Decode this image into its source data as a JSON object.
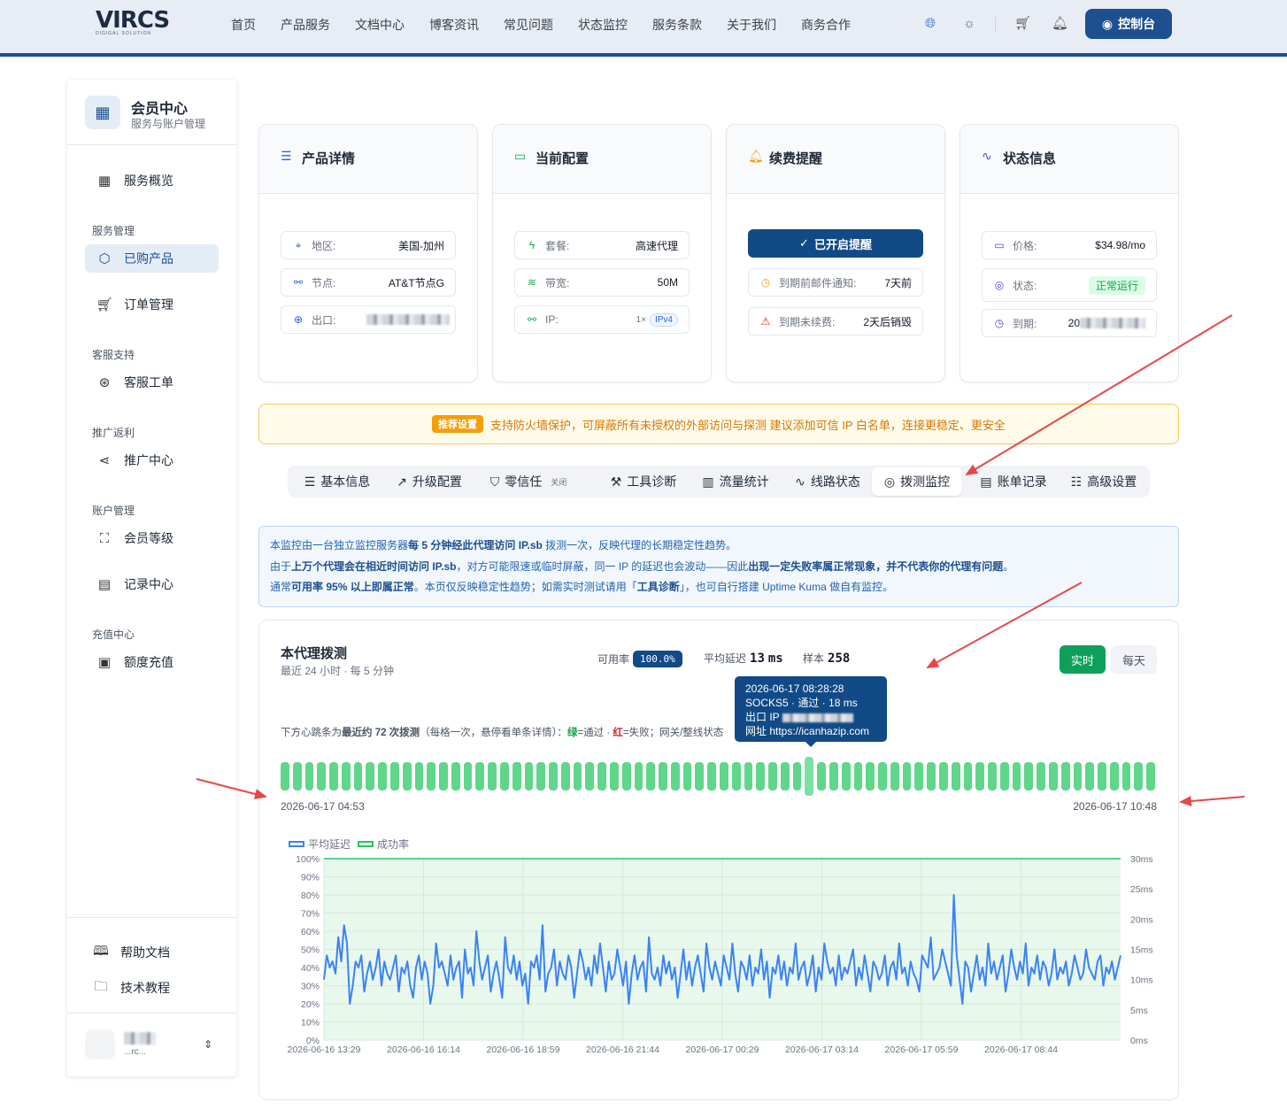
{
  "brand": {
    "logo": "VIRCS",
    "tagline": "DIGIGAL SOLUTION"
  },
  "nav": [
    "首页",
    "产品服务",
    "文档中心",
    "博客资讯",
    "常见问题",
    "状态监控",
    "服务条款",
    "关于我们",
    "商务合作"
  ],
  "console_label": "控制台",
  "sidebar": {
    "title": "会员中心",
    "subtitle": "服务与账户管理",
    "overview": "服务概览",
    "groups": [
      {
        "label": "服务管理",
        "items": [
          "已购产品",
          "订单管理"
        ]
      },
      {
        "label": "客服支持",
        "items": [
          "客服工单"
        ]
      },
      {
        "label": "推广返利",
        "items": [
          "推广中心"
        ]
      },
      {
        "label": "账户管理",
        "items": [
          "会员等级",
          "记录中心"
        ]
      },
      {
        "label": "充值中心",
        "items": [
          "额度充值"
        ]
      }
    ],
    "bottom": [
      "帮助文档",
      "技术教程"
    ]
  },
  "cards": {
    "product": {
      "title": "产品详情",
      "region_label": "地区:",
      "region": "美国-加州",
      "node_label": "节点:",
      "node": "AT&T节点G",
      "exit_label": "出口:"
    },
    "config": {
      "title": "当前配置",
      "plan_label": "套餐:",
      "plan": "高速代理",
      "bw_label": "带宽:",
      "bw": "50M",
      "ip_label": "IP:",
      "ip_count": "1×",
      "ip_type": "IPv4"
    },
    "renew": {
      "title": "续费提醒",
      "enabled": "已开启提醒",
      "mail_label": "到期前邮件通知:",
      "mail": "7天前",
      "expire_label": "到期未续费:",
      "expire": "2天后销毁"
    },
    "status": {
      "title": "状态信息",
      "price_label": "价格:",
      "price": "$34.98/mo",
      "state_label": "状态:",
      "state": "正常运行",
      "due_label": "到期:",
      "due": "20"
    }
  },
  "notice": {
    "tag": "推荐设置",
    "text": "支持防火墙保护，可屏蔽所有未授权的外部访问与探测  建议添加可信 IP 白名单，连接更稳定、更安全"
  },
  "tabs": [
    {
      "label": "基本信息",
      "icon": "server-icon"
    },
    {
      "label": "升级配置",
      "icon": "trend-icon"
    },
    {
      "label": "零信任",
      "icon": "shield-icon",
      "extra": "关闭"
    },
    {
      "label": "工具诊断",
      "icon": "wrench-icon"
    },
    {
      "label": "流量统计",
      "icon": "bar-chart-icon"
    },
    {
      "label": "线路状态",
      "icon": "activity-icon"
    },
    {
      "label": "拨测监控",
      "icon": "radar-icon",
      "active": true
    },
    {
      "label": "账单记录",
      "icon": "receipt-icon"
    },
    {
      "label": "高级设置",
      "icon": "sliders-icon"
    }
  ],
  "info": {
    "l1a": "本监控由一台独立监控服务器",
    "l1b": "每 5 分钟经此代理访问 IP.sb",
    "l1c": " 拨测一次，反映代理的长期稳定性趋势。",
    "l2a": "由于",
    "l2b": "上万个代理会在相近时间访问 IP.sb",
    "l2c": "，对方可能限速或临时屏蔽，同一 IP 的延迟也会波动——因此",
    "l2d": "出现一定失败率属正常现象，并不代表你的代理有问题",
    "l2e": "。",
    "l3a": "通常",
    "l3b": "可用率 95% 以上即属正常",
    "l3c": "。本页仅反映稳定性趋势；如需实时测试请用「",
    "l3d": "工具诊断",
    "l3e": "」，也可自行搭建 Uptime Kuma 做自有监控。"
  },
  "probe": {
    "title": "本代理拨测",
    "subtitle": "最近 24 小时 · 每 5 分钟",
    "avail_label": "可用率",
    "avail": "100.0%",
    "latency_label": "平均延迟",
    "latency": "13",
    "latency_unit": "ms",
    "sample_label": "样本",
    "sample": "258",
    "btn_realtime": "实时",
    "btn_daily": "每天",
    "hint_a": "下方心跳条为",
    "hint_b": "最近约 72 次拨测",
    "hint_c": "（每格一次，悬停看单条详情）：",
    "hint_green": "绿",
    "hint_d": "=通过 · ",
    "hint_red": "红",
    "hint_e": "=失败；网关/整线状态",
    "beats_count": 72,
    "beat_highlight": 43,
    "start": "2026-06-17 04:53",
    "end": "2026-06-17 10:48",
    "tooltip": {
      "time": "2026-06-17 08:28:28",
      "line2": "SOCKS5 · 通过 · 18 ms",
      "line3": "出口 IP",
      "line4": "网址 https://icanhazip.com"
    }
  },
  "chart_data": {
    "type": "line",
    "legend": [
      "平均延迟",
      "成功率"
    ],
    "colors": {
      "latency": "#3b82f6",
      "success": "#22c55e"
    },
    "y_left": [
      "100%",
      "90%",
      "80%",
      "70%",
      "60%",
      "50%",
      "40%",
      "30%",
      "20%",
      "10%",
      "0%"
    ],
    "y_right": [
      "30ms",
      "25ms",
      "20ms",
      "15ms",
      "10ms",
      "5ms",
      "0ms"
    ],
    "x_labels": [
      "2026-06-16 13:29",
      "2026-06-16 16:14",
      "2026-06-16 18:59",
      "2026-06-16 21:44",
      "2026-06-17 00:29",
      "2026-06-17 03:14",
      "2026-06-17 05:59",
      "2026-06-17 08:44"
    ],
    "success_rate": 100,
    "latency_ms": [
      10,
      14,
      12,
      13,
      11,
      17,
      13,
      19,
      16,
      6,
      9,
      13,
      12,
      14,
      8,
      11,
      13,
      10,
      12,
      15,
      9,
      13,
      11,
      10,
      12,
      14,
      8,
      12,
      11,
      13,
      9,
      7,
      12,
      14,
      10,
      13,
      11,
      6,
      9,
      16,
      12,
      13,
      11,
      9,
      14,
      10,
      12,
      13,
      7,
      15,
      11,
      12,
      9,
      18,
      13,
      10,
      12,
      14,
      8,
      11,
      13,
      10,
      7,
      17,
      12,
      11,
      14,
      10,
      13,
      9,
      11,
      6,
      13,
      12,
      14,
      10,
      19,
      8,
      11,
      12,
      15,
      9,
      13,
      11,
      10,
      14,
      12,
      7,
      11,
      15,
      13,
      10,
      12,
      9,
      14,
      11,
      16,
      12,
      8,
      13,
      10,
      11,
      15,
      12,
      9,
      13,
      6,
      11,
      14,
      10,
      12,
      13,
      8,
      17,
      11,
      10,
      12,
      9,
      14,
      11,
      13,
      10,
      12,
      7,
      11,
      15,
      10,
      13,
      9,
      12,
      14,
      11,
      8,
      16,
      12,
      10,
      13,
      11,
      9,
      14,
      12,
      10,
      16,
      11,
      8,
      13,
      12,
      10,
      14,
      9,
      12,
      11,
      15,
      10,
      13,
      7,
      12,
      11,
      14,
      10,
      13,
      9,
      12,
      11,
      16,
      10,
      12,
      13,
      9,
      11,
      14,
      8,
      12,
      10,
      16,
      13,
      11,
      12,
      9,
      14,
      10,
      12,
      11,
      13,
      15,
      9,
      12,
      10,
      14,
      11,
      8,
      13,
      12,
      10,
      11,
      14,
      9,
      12,
      13,
      10,
      16,
      11,
      12,
      9,
      13,
      11,
      10,
      8,
      14,
      13,
      12,
      17,
      10,
      11,
      12,
      15,
      13,
      11,
      9,
      24,
      14,
      10,
      6,
      13,
      12,
      8,
      11,
      14,
      10,
      12,
      9,
      16,
      11,
      13,
      10,
      12,
      14,
      8,
      11,
      15,
      12,
      10,
      13,
      11,
      16,
      9,
      12,
      11,
      14,
      10,
      13,
      12,
      9,
      11,
      15,
      10,
      12,
      11,
      13,
      9,
      11,
      14,
      12,
      10,
      11,
      15,
      12,
      11,
      10,
      13,
      14,
      9,
      12,
      11,
      13,
      10,
      12,
      14
    ]
  },
  "user": {
    "name": "▉▉▉",
    "email": "...rc..."
  }
}
